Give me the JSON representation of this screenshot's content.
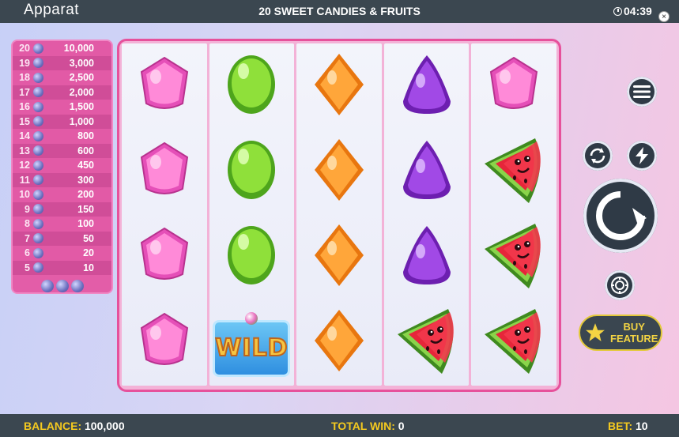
{
  "topbar": {
    "logo": "Apparat",
    "title": "20 SWEET CANDIES & FRUITS",
    "time": "04:39",
    "close": "×"
  },
  "paytable": [
    {
      "count": "20",
      "value": "10,000"
    },
    {
      "count": "19",
      "value": "3,000"
    },
    {
      "count": "18",
      "value": "2,500"
    },
    {
      "count": "17",
      "value": "2,000"
    },
    {
      "count": "16",
      "value": "1,500"
    },
    {
      "count": "15",
      "value": "1,000"
    },
    {
      "count": "14",
      "value": "800"
    },
    {
      "count": "13",
      "value": "600"
    },
    {
      "count": "12",
      "value": "450"
    },
    {
      "count": "11",
      "value": "300"
    },
    {
      "count": "10",
      "value": "200"
    },
    {
      "count": "9",
      "value": "150"
    },
    {
      "count": "8",
      "value": "100"
    },
    {
      "count": "7",
      "value": "50"
    },
    {
      "count": "6",
      "value": "20"
    },
    {
      "count": "5",
      "value": "10"
    }
  ],
  "reels": [
    [
      "pink-candy",
      "pink-candy",
      "pink-candy",
      "pink-candy"
    ],
    [
      "green-candy",
      "green-candy",
      "green-candy",
      "wild"
    ],
    [
      "orange-candy",
      "orange-candy",
      "orange-candy",
      "orange-candy"
    ],
    [
      "purple-candy",
      "purple-candy",
      "purple-candy",
      "watermelon"
    ],
    [
      "pink-candy",
      "watermelon",
      "watermelon",
      "watermelon"
    ]
  ],
  "wild_text": "WILD",
  "buy": {
    "line1": "BUY",
    "line2": "FEATURE"
  },
  "bottom": {
    "balance_label": "BALANCE:",
    "balance": "100,000",
    "win_label": "TOTAL WIN:",
    "win": "0",
    "bet_label": "BET:",
    "bet": "10"
  },
  "colors": {
    "bar": "#3b4750",
    "label": "#f4c91f",
    "frame": "#e6519b"
  }
}
